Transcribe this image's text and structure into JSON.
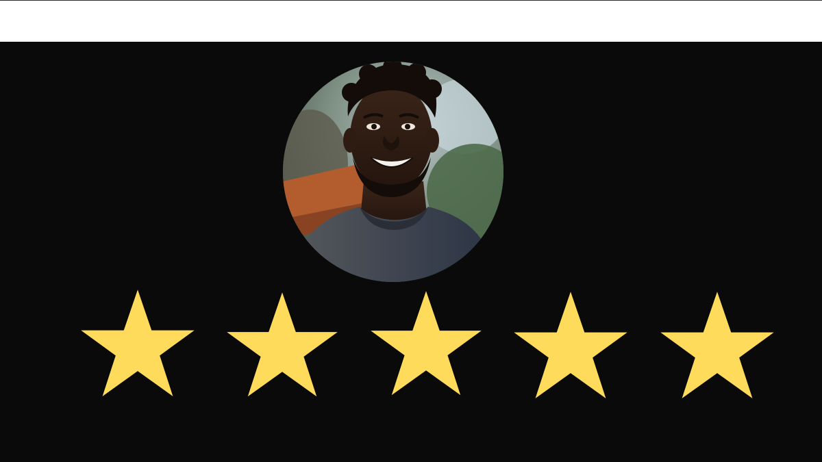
{
  "rating": {
    "value": 5,
    "max": 5,
    "star_color": "#FFDB5C"
  },
  "avatar": {
    "icon": "portrait-photo"
  },
  "colors": {
    "background": "#0A0A0A",
    "top_band": "#FFFFFF"
  }
}
